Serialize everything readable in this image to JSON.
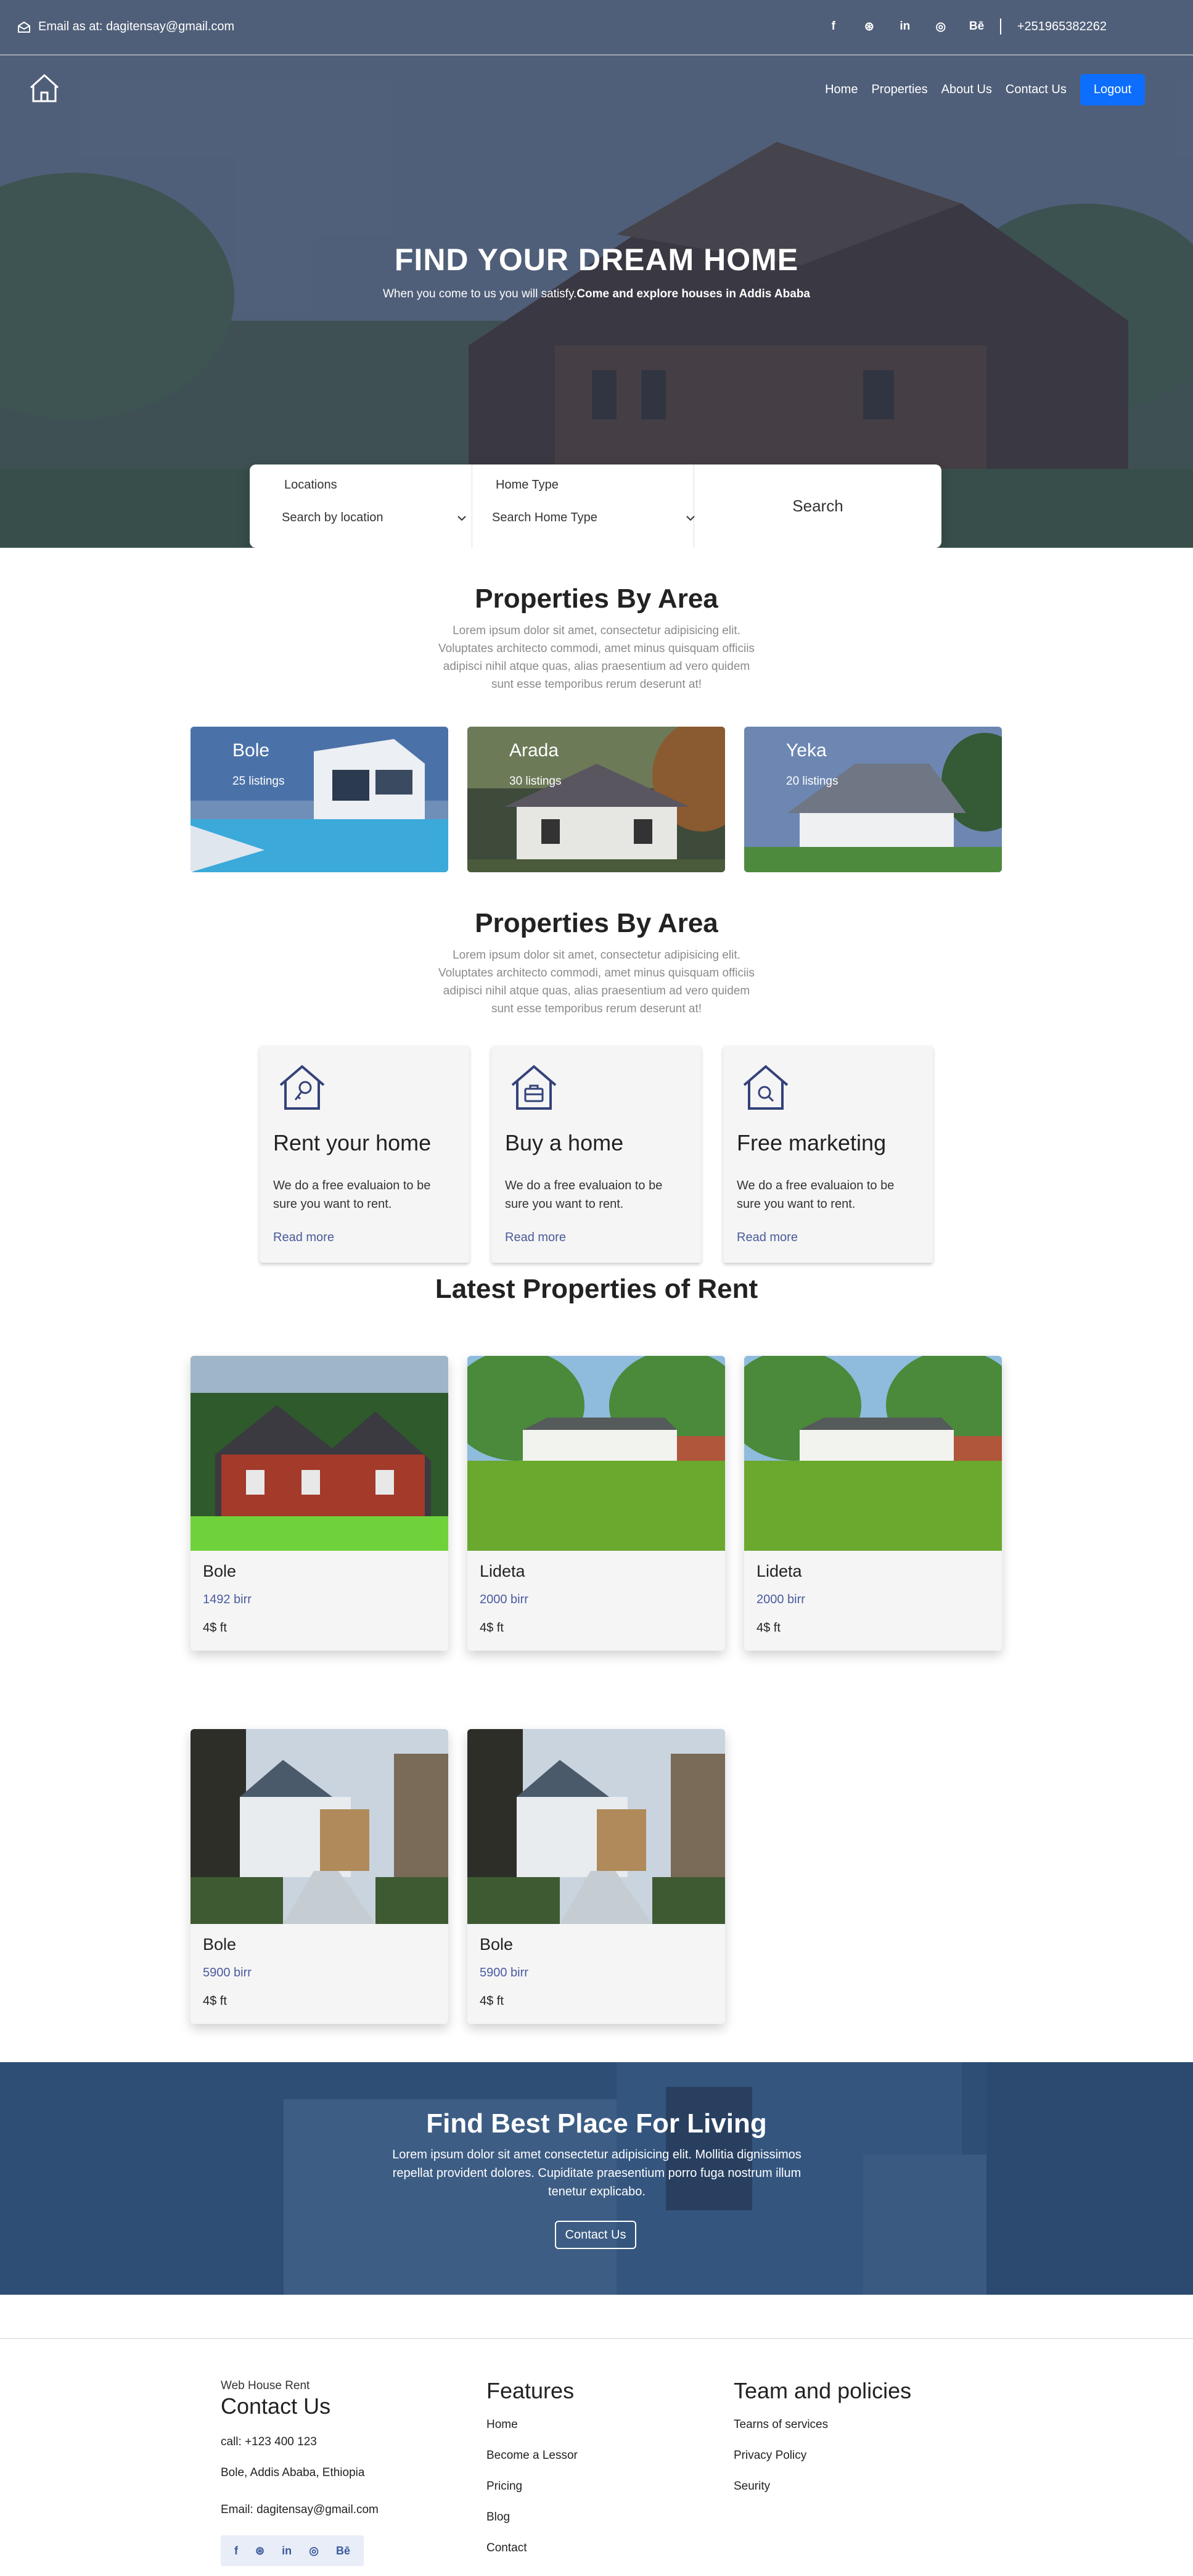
{
  "topbar": {
    "email": "Email as at: dagitensay@gmail.com",
    "phone": "+251965382262",
    "social": [
      "f",
      "⊛",
      "in",
      "◎",
      "Bē"
    ]
  },
  "nav": {
    "links": [
      "Home",
      "Properties",
      "About Us",
      "Contact Us"
    ],
    "logout": "Logout"
  },
  "hero": {
    "title": "FIND YOUR DREAM HOME",
    "subtitle_plain": "When you come to us you will satisfy.",
    "subtitle_bold": "Come and explore houses in Addis Ababa"
  },
  "search": {
    "location_label": "Locations",
    "location_value": "Search by location",
    "type_label": "Home Type",
    "type_value": "Search Home Type",
    "button": "Search"
  },
  "areas_section": {
    "title": "Properties By Area",
    "description": "Lorem ipsum dolor sit amet, consectetur adipisicing elit. Voluptates architecto commodi, amet minus quisquam officiis adipisci nihil atque quas, alias praesentium ad vero quidem sunt esse temporibus rerum deserunt at!",
    "cards": [
      {
        "name": "Bole",
        "count": "25 listings"
      },
      {
        "name": "Arada",
        "count": "30 listings"
      },
      {
        "name": "Yeka",
        "count": "20 listings"
      }
    ]
  },
  "services_section": {
    "title": "Properties By Area",
    "description": "Lorem ipsum dolor sit amet, consectetur adipisicing elit. Voluptates architecto commodi, amet minus quisquam officiis adipisci nihil atque quas, alias praesentium ad vero quidem sunt esse temporibus rerum deserunt at!",
    "cards": [
      {
        "title": "Rent your home",
        "text": "We do a free evaluaion to be sure you want to rent.",
        "link": "Read more",
        "icon": "house-key-icon"
      },
      {
        "title": "Buy a home",
        "text": "We do a free evaluaion to be sure you want to rent.",
        "link": "Read more",
        "icon": "house-briefcase-icon"
      },
      {
        "title": "Free marketing",
        "text": "We do a free evaluaion to be sure you want to rent.",
        "link": "Read more",
        "icon": "house-search-icon"
      }
    ]
  },
  "latest_section": {
    "title": "Latest Properties of Rent",
    "properties": [
      {
        "name": "Bole",
        "price": "1492 birr",
        "area": "4$ ft"
      },
      {
        "name": "Lideta",
        "price": "2000 birr",
        "area": "4$ ft"
      },
      {
        "name": "Lideta",
        "price": "2000 birr",
        "area": "4$ ft"
      },
      {
        "name": "Bole",
        "price": "5900 birr",
        "area": "4$ ft"
      },
      {
        "name": "Bole",
        "price": "5900 birr",
        "area": "4$ ft"
      }
    ]
  },
  "cta": {
    "title": "Find Best Place For Living",
    "text": "Lorem ipsum dolor sit amet consectetur adipisicing elit. Mollitia dignissimos repellat provident dolores. Cupiditate praesentium porro fuga nostrum illum tenetur explicabo.",
    "button": "Contact Us"
  },
  "footer": {
    "brand": "Web House Rent",
    "contact_title": "Contact Us",
    "call": "call: +123 400 123",
    "address": "Bole, Addis Ababa, Ethiopia",
    "email": "Email: dagitensay@gmail.com",
    "features_title": "Features",
    "features": [
      "Home",
      "Become a Lessor",
      "Pricing",
      "Blog",
      "Contact"
    ],
    "team_title": "Team and policies",
    "policies": [
      "Tearns of services",
      "Privacy Policy",
      "Seurity"
    ],
    "social": [
      "f",
      "⊛",
      "in",
      "◎",
      "Bē"
    ]
  },
  "colors": {
    "accent": "#0d6efd",
    "link": "#4a5aa0",
    "cta_bg": "#2e4f78"
  }
}
